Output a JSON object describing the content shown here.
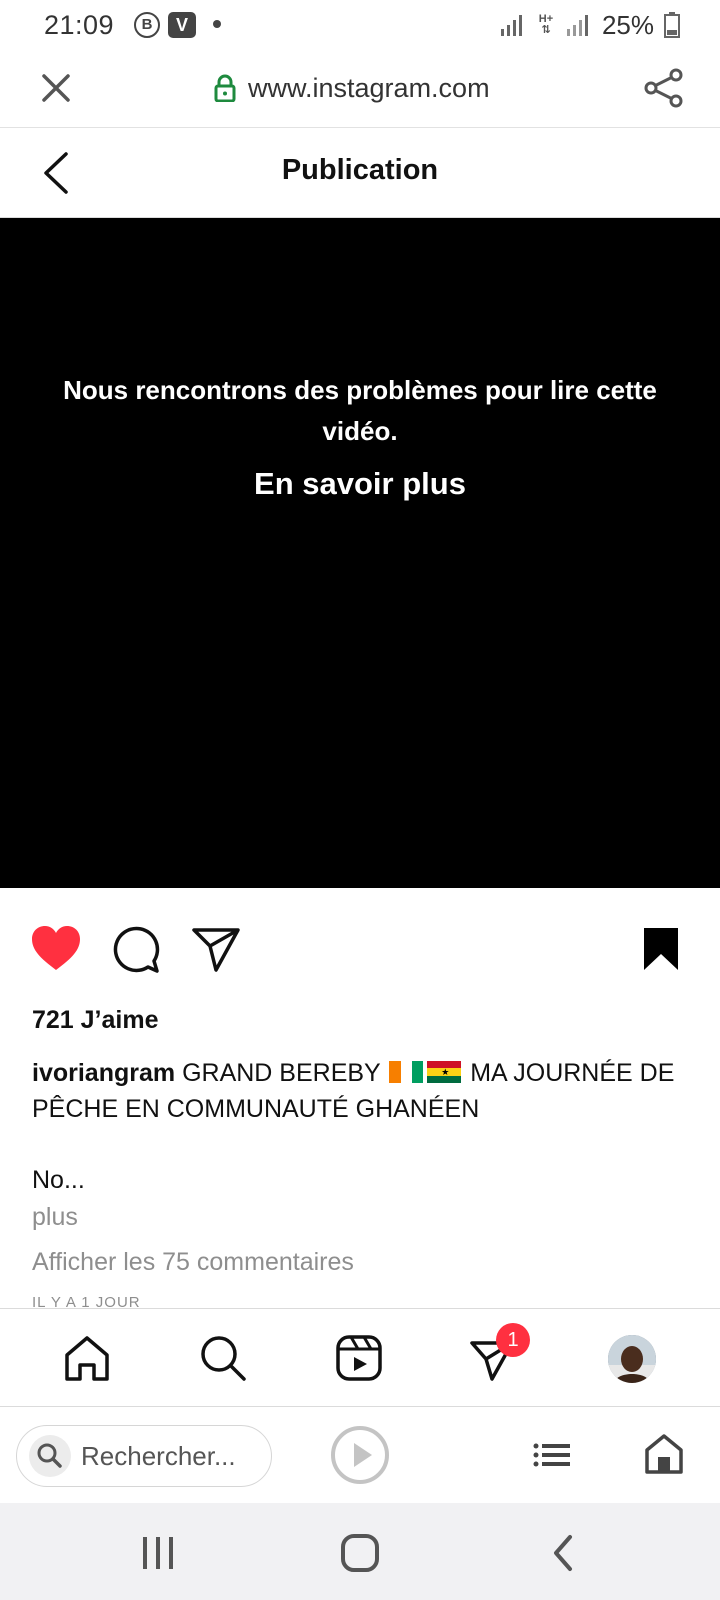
{
  "status_bar": {
    "time": "21:09",
    "b_badge": "B",
    "v_badge": "V",
    "net_label": "H+",
    "battery": "25%"
  },
  "browser": {
    "url": "www.instagram.com"
  },
  "header": {
    "title": "Publication"
  },
  "video": {
    "error_message": "Nous rencontrons des problèmes pour lire cette vidéo.",
    "learn_more": "En savoir plus"
  },
  "post": {
    "likes": "721 J’aime",
    "username": "ivoriangram",
    "caption_before_flags": "GRAND BEREBY",
    "caption_after_flags": "MA JOURNÉE DE PÊCHE EN COMMUNAUTÉ GHANÉEN",
    "caption_truncated": "No...",
    "more_label": "plus",
    "comments_link": "Afficher les 75 commentaires",
    "timestamp": "IL Y A 1 JOUR",
    "liked": true
  },
  "ig_nav": {
    "messages_badge": "1"
  },
  "browser_bottom": {
    "search_placeholder": "Rechercher..."
  },
  "colors": {
    "like_red": "#ff3040",
    "lock_green": "#1e8a3e",
    "muted_text": "#8e8e8e"
  },
  "icons": [
    "close-icon",
    "lock-icon",
    "share-icon",
    "back-icon",
    "heart-icon",
    "comment-icon",
    "send-icon",
    "bookmark-icon",
    "home-icon",
    "search-icon",
    "reels-icon",
    "messages-icon",
    "play-icon",
    "menu-icon",
    "browser-home-icon"
  ]
}
